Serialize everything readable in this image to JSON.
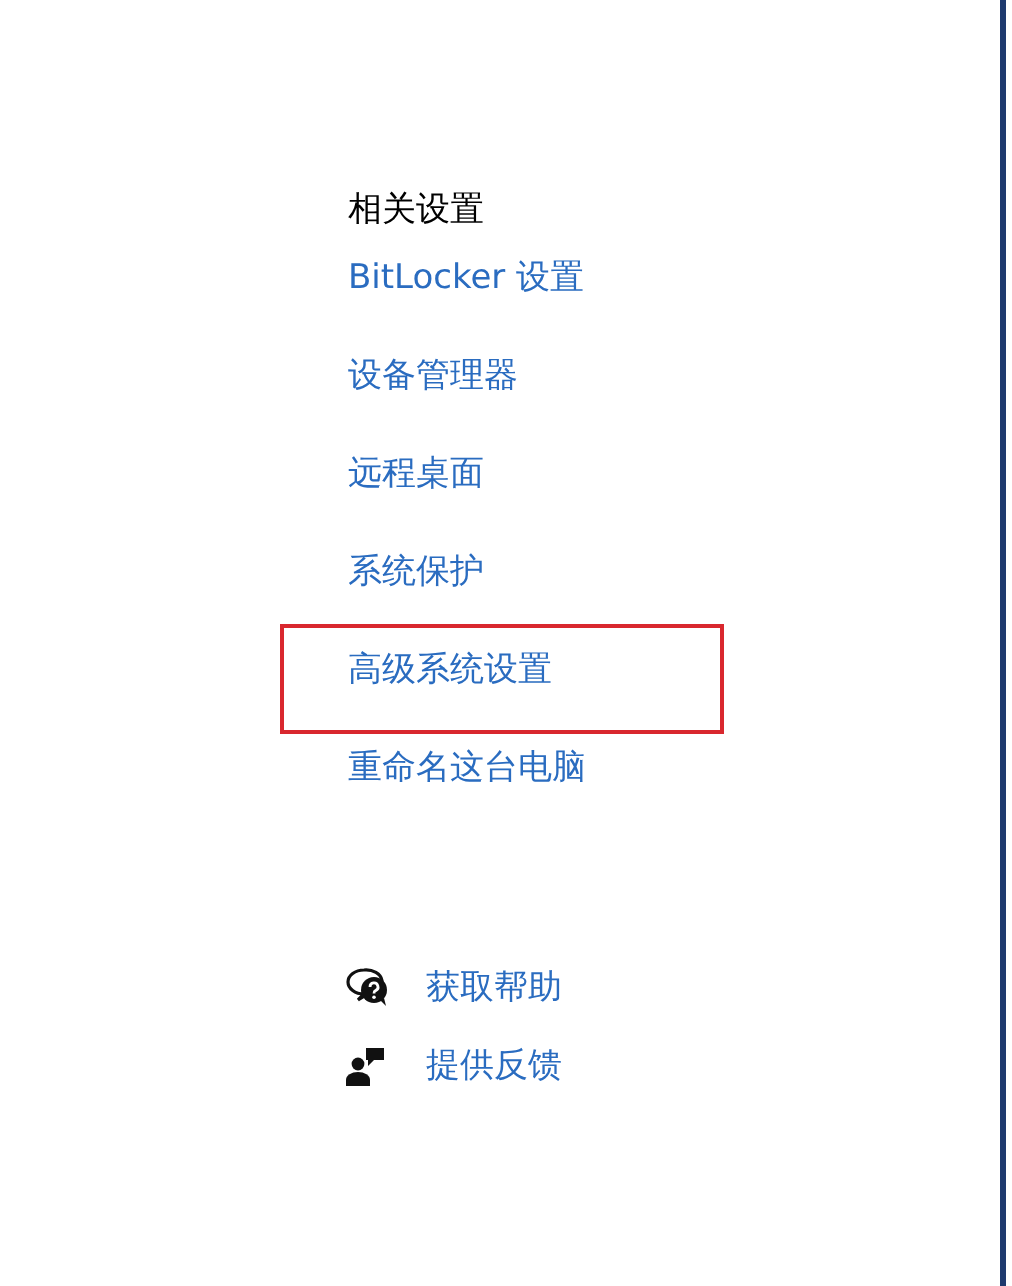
{
  "related_settings": {
    "heading": "相关设置",
    "links": [
      {
        "label": "BitLocker 设置",
        "highlighted": false
      },
      {
        "label": "设备管理器",
        "highlighted": false
      },
      {
        "label": "远程桌面",
        "highlighted": false
      },
      {
        "label": "系统保护",
        "highlighted": false
      },
      {
        "label": "高级系统设置",
        "highlighted": true
      },
      {
        "label": "重命名这台电脑",
        "highlighted": false
      }
    ]
  },
  "support": [
    {
      "kind": "help",
      "label": "获取帮助"
    },
    {
      "kind": "feedback",
      "label": "提供反馈"
    }
  ]
}
